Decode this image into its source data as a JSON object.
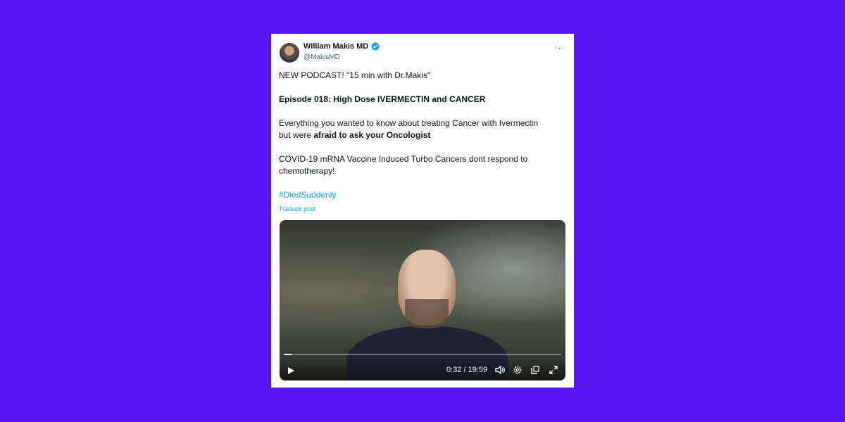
{
  "tweet": {
    "author_name": "William Makis MD",
    "author_handle": "@MakisMD",
    "more_label": "···",
    "line1": "NEW PODCAST! \"15 min with Dr.Makis\"",
    "line2": "Episode 018: High Dose IVERMECTIN and CANCER",
    "line3a": "Everything you wanted to know about treating Cancer with Ivermectin",
    "line3b_prefix": "but were ",
    "line3b_bold": "afraid to ask your Oncologist",
    "line4": "COVID-19 mRNA Vaccine Induced Turbo Cancers dont respond to chemotherapy!",
    "hashtag": "#DiedSuddenly",
    "translate_label": "Traducir post"
  },
  "video": {
    "current_time": "0:32",
    "duration": "19:59",
    "time_text": "0:32 / 19:59",
    "progress_fraction": 0.027
  },
  "colors": {
    "background": "#5a16f0",
    "link": "#1d9bf0",
    "verified": "#1d9bf0"
  },
  "icons": [
    "verified-badge-icon",
    "more-icon",
    "play-icon",
    "volume-icon",
    "settings-icon",
    "dock-icon",
    "fullscreen-icon"
  ]
}
